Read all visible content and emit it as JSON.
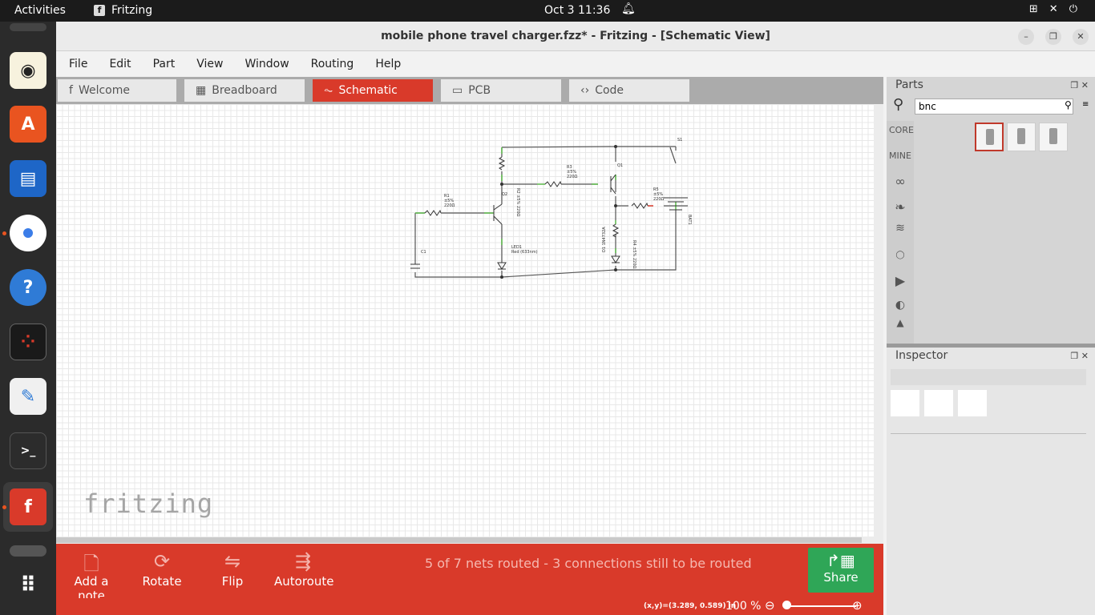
{
  "topbar": {
    "activities": "Activities",
    "app_name": "Fritzing",
    "app_letter": "f",
    "datetime": "Oct 3  11:36"
  },
  "window": {
    "title": "mobile phone travel charger.fzz* - Fritzing - [Schematic View]"
  },
  "menu": [
    "File",
    "Edit",
    "Part",
    "View",
    "Window",
    "Routing",
    "Help"
  ],
  "tabs": [
    {
      "label": "Welcome",
      "icon": "f"
    },
    {
      "label": "Breadboard",
      "icon": "▦"
    },
    {
      "label": "Schematic",
      "icon": "⏦"
    },
    {
      "label": "PCB",
      "icon": "▭"
    },
    {
      "label": "Code",
      "icon": "‹›"
    }
  ],
  "schematic": {
    "labels": {
      "s1": "S1",
      "q1": "Q1",
      "q2": "Q2",
      "r1": [
        "R1",
        "±5%",
        "220Ω"
      ],
      "r2": "R2 ±5% 220Ω",
      "r3": [
        "R3",
        "±5%",
        "220Ω"
      ],
      "r4": "R4 ±5% 220Ω",
      "r5": [
        "R5",
        "±5%",
        "220Ω"
      ],
      "c1": "C1",
      "led1": [
        "LED1",
        "Red (633nm)"
      ],
      "d1": "D1 1N4732A",
      "bat1": "BAT1"
    }
  },
  "logo": "fritzing",
  "toolbar": {
    "add_note": "Add a note",
    "rotate": "Rotate",
    "flip": "Flip",
    "autoroute": "Autoroute",
    "share": "Share",
    "status": "5 of 7 nets routed - 3 connections still to be routed"
  },
  "footer": {
    "coords": "(x,y)=(3.289, 0.589) in",
    "zoom": "100 %"
  },
  "parts": {
    "title": "Parts",
    "search_value": "bnc",
    "bins": [
      "CORE",
      "MINE"
    ],
    "results": [
      "bnc-connector-1",
      "bnc-connector-2",
      "bnc-connector-3"
    ]
  },
  "inspector": {
    "title": "Inspector"
  },
  "colors": {
    "accent": "#d93a2a",
    "share": "#2fa657",
    "wire": "#555555",
    "pin": "#5ab948"
  }
}
